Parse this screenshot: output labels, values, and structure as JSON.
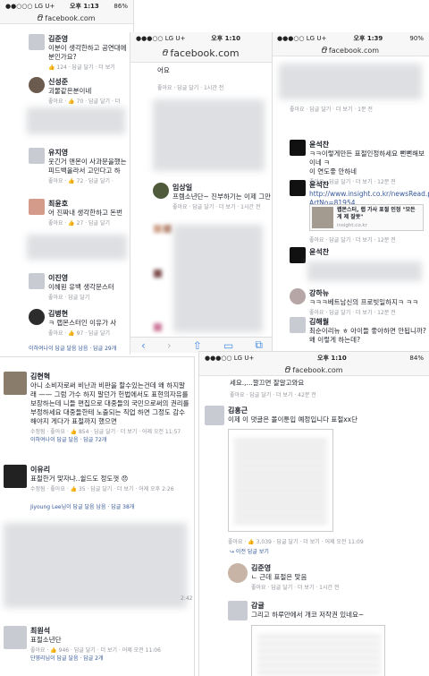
{
  "s1": {
    "status": {
      "carrier": "●●○○○ LG U+",
      "time": "오후 1:13",
      "battery": "86%"
    },
    "url": "facebook.com",
    "comments": [
      {
        "name": "김준영",
        "lines": [
          "이분이 생각한하고 공연대에",
          "분인가요?"
        ],
        "meta": "👍 124 · 답글 달기 · 더 보기"
      },
      {
        "name": "신성준",
        "lines": [
          "괴물같은분이네"
        ],
        "meta": "좋아요 · 👍 70 · 답글 달기 · 더"
      },
      {
        "name": "유지영",
        "lines": [
          "웃긴거 맨몬이 사과문을했는",
          "피드백올라서 고민다고 하"
        ],
        "meta": "좋아요 · 👍 72 · 답글 달기 ·"
      },
      {
        "name": "최윤호",
        "lines": [
          "어 진짜내 생각한하고 돈번"
        ],
        "meta": "좋아요 · 👍 27 · 답글 달기"
      },
      {
        "name": "이진영",
        "lines": [
          "이혜원 유백 생각문스터"
        ],
        "meta": "좋아요 · 답글 달기"
      },
      {
        "name": "김병현",
        "lines": [
          "ㅋ 랩몬스터인 이유가 사"
        ],
        "meta": "좋아요 · 👍 97 · 답글 달기"
      }
    ],
    "footer": "이하여나이 답글 달음 남음 · 답글 29개"
  },
  "s2": {
    "status": {
      "carrier": "●●●○○ LG U+",
      "time": "오후 1:10"
    },
    "url": "facebook.com",
    "top_line": "어요",
    "top_meta": "좋아요 · 답글 달기 · 1시간 전",
    "comment": {
      "name": "임상일",
      "lines": [
        "프렘소년단~ 진부하기는 이제 그만"
      ],
      "meta": "좋아요 · 답글 달기 · 더 보기 · 1시간 전"
    }
  },
  "s3": {
    "status": {
      "carrier": "●●●○○ LG U+",
      "time": "오후 1:39",
      "battery": "90%"
    },
    "url": "facebook.com",
    "comments": [
      {
        "name": "윤석찬",
        "lines": [
          "ㅋㅋ이렇게만든 표절인정하세요 뻔뻔해보이네 ㅋ",
          "이 연도좋 안하네"
        ],
        "meta": "좋아요 · 답글 달기 · 더 보기 · 12분 전"
      },
      {
        "name": "윤석찬",
        "lines": [
          "http://www.insight.co.kr/newsRead.php?",
          "ArtNo=81954"
        ],
        "meta": ""
      },
      {
        "name": "윤석찬",
        "lines": [],
        "meta": ""
      },
      {
        "name": "강하뉴",
        "lines": [
          "ㅋㅋㅋ베트남신의 프로빗일하지ㅋ ㅋㅋ"
        ],
        "meta": "좋아요 · 답글 달기 · 더 보기 · 12분 전"
      },
      {
        "name": "김해월",
        "lines": [
          "최순이리뉴    ㅎ 아이들 좋아하면 안됩니까? 왜 이렇게 하는데?"
        ],
        "meta": ""
      }
    ],
    "link_card": {
      "title": "랩몬스터, 랩 가사 표절 인정 \"모든 게 제 잘못\"",
      "domain": "insight.co.kr"
    },
    "top_meta": "좋아요 · 답글 달기 · 더 보기 · 1분 전",
    "mid_meta": "좋아요 · 답글 달기 · 더 보기 · 12분 전"
  },
  "s4": {
    "comments": [
      {
        "name": "김현혁",
        "lines": [
          "아니 소비자로써 비난과 비판을 할수있는건데 왜 하지말",
          "래 —— 그럼 가수 하지 말던가 헌법에서도 표현의자유를",
          "보장하는데 니들 편집으로 대중들의 국민으로써의 권리를",
          "부정하세요 대중들한테 노출되는 직업 하면 그정도 감수",
          "해야지 게다가 표절까지 했으면"
        ],
        "meta": "수정됨 · 좋아요 · 👍 854 · 답글 달기 · 더 보기 · 어제 오전 11:57",
        "reply": "이하여나이 답글 달음 · 답글 72개"
      },
      {
        "name": "이유리",
        "lines": [
          "표절한거 맞자냐..쉴드도 정도껏 😞"
        ],
        "meta": "수정됨 · 좋아요 · 👍 35 · 답글 달기 · 더 보기 · 어제 오후 2:26",
        "reply": "Jiyoung Lee님이 답글 달음 남음 · 답글 38개"
      },
      {
        "name": "최원석",
        "lines": [
          "표절소년단"
        ],
        "meta": "좋아요 · 👍 946 · 답글 달기 · 더 보기 · 어제 오전 11:06",
        "reply": "단영리님이 답글 달음 · 답글 2개"
      }
    ],
    "side_time": "2:42"
  },
  "s5": {
    "status": {
      "carrier": "●●●○○ LG U+",
      "time": "오후 1:10",
      "battery": "84%"
    },
    "url": "facebook.com",
    "top_line": "세요.,...깔끄면 잘알고와요",
    "top_meta": "좋아요 · 답글 달기 · 더 보기 · 42분 전",
    "comments": [
      {
        "name": "김홍근",
        "lines": [
          "이제 이 댓글은 몰이툰입 예정입니다 표절xx단"
        ],
        "meta": "좋아요 · 👍 3,039 · 답글 달기 · 더 보기 · 어제 오전 11:09",
        "reply": "↪ 이전 답글 보기"
      },
      {
        "name": "김준영",
        "lines": [
          "ㄴ 근데 표절은 맞음"
        ],
        "meta": "좋아요 · 답글 달기 · 더 보기 · 1시간 전"
      },
      {
        "name": "감귤",
        "lines": [
          "그리고 하루만에서 개코 저작권 있네요~"
        ],
        "meta": ""
      }
    ]
  }
}
